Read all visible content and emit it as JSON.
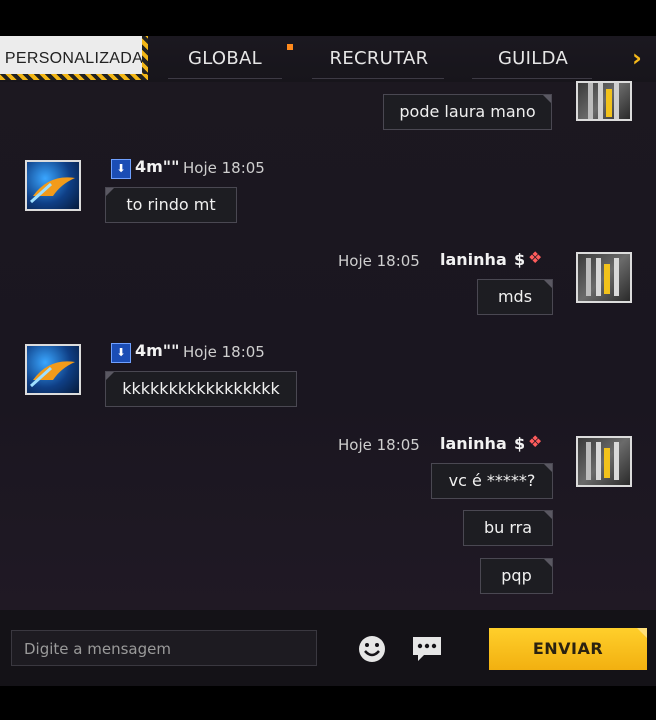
{
  "tabs": [
    {
      "label": "PERSONALIZADA"
    },
    {
      "label": "GLOBAL"
    },
    {
      "label": "RECRUTAR"
    },
    {
      "label": "GUILDA"
    }
  ],
  "messages": [
    {
      "text": "pode laura mano"
    },
    {
      "sender": "4m\"\"",
      "time": "Hoje 18:05",
      "text": "to rindo mt"
    },
    {
      "sender": "laninha",
      "symbol": "$",
      "time": "Hoje 18:05",
      "text": "mds"
    },
    {
      "sender": "4m\"\"",
      "time": "Hoje 18:05",
      "text": "kkkkkkkkkkkkkkkkk"
    },
    {
      "sender": "laninha",
      "symbol": "$",
      "time": "Hoje 18:05",
      "texts": [
        "vc é *****?",
        "bu rra",
        "pqp"
      ]
    }
  ],
  "input": {
    "placeholder": "Digite a mensagem"
  },
  "send": {
    "label": "ENVIAR"
  },
  "colors": {
    "accent": "#f6b91a",
    "notif": "#ff8a1c"
  }
}
